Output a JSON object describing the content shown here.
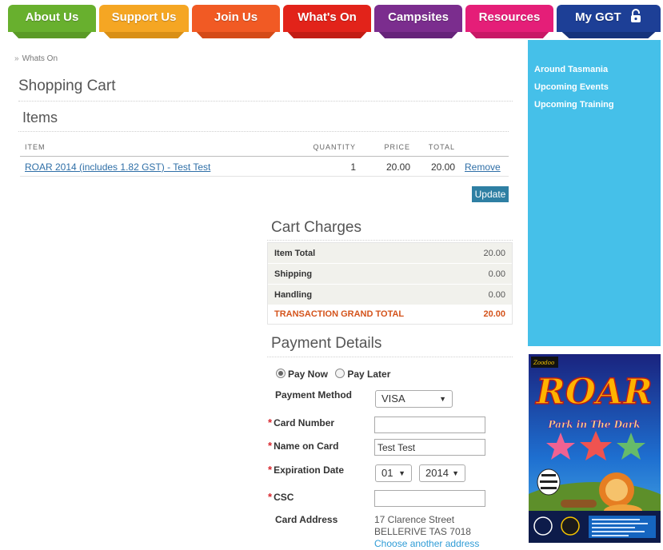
{
  "nav": {
    "tabs": [
      {
        "label": "About Us",
        "color": "#68b02e"
      },
      {
        "label": "Support Us",
        "color": "#f5a623"
      },
      {
        "label": "Join Us",
        "color": "#f15a24"
      },
      {
        "label": "What's On",
        "color": "#e2231a"
      },
      {
        "label": "Campsites",
        "color": "#7b2d8e"
      },
      {
        "label": "Resources",
        "color": "#e51e78"
      },
      {
        "label": "My GGT",
        "color": "#1d3f96"
      }
    ]
  },
  "breadcrumb": {
    "sep": "»",
    "current": "Whats On"
  },
  "page_title": "Shopping Cart",
  "items": {
    "heading": "Items",
    "columns": [
      "ITEM",
      "QUANTITY",
      "PRICE",
      "TOTAL"
    ],
    "rows": [
      {
        "item": "ROAR 2014 (includes 1.82 GST) - Test Test",
        "quantity": "1",
        "price": "20.00",
        "total": "20.00",
        "action": "Remove"
      }
    ],
    "update_label": "Update"
  },
  "cart_charges": {
    "heading": "Cart Charges",
    "rows": [
      {
        "label": "Item Total",
        "value": "20.00"
      },
      {
        "label": "Shipping",
        "value": "0.00"
      },
      {
        "label": "Handling",
        "value": "0.00"
      }
    ],
    "grand_total": {
      "label": "TRANSACTION GRAND TOTAL",
      "value": "20.00"
    }
  },
  "payment": {
    "heading": "Payment Details",
    "pay_now": "Pay Now",
    "pay_later": "Pay Later",
    "method_label": "Payment Method",
    "method_value": "VISA",
    "card_number_label": "Card Number",
    "card_number_value": "",
    "name_label": "Name on Card",
    "name_value": "Test Test",
    "expiry_label": "Expiration Date",
    "expiry_month": "01",
    "expiry_year": "2014",
    "csc_label": "CSC",
    "csc_value": "",
    "address_label": "Card Address",
    "address_line1": "17 Clarence Street",
    "address_line2": "BELLERIVE TAS 7018",
    "address_link": "Choose another address"
  },
  "sidebar": {
    "links": [
      "Around Tasmania",
      "Upcoming Events",
      "Upcoming Training"
    ]
  },
  "poster": {
    "title": "ROAR",
    "subtitle": "Park in The Dark",
    "brand": "Zoodoo"
  }
}
